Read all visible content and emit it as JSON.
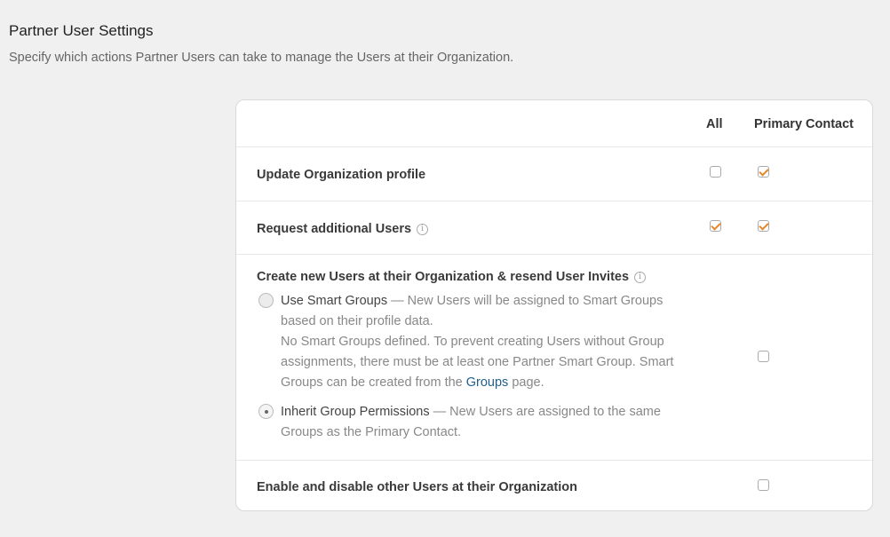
{
  "header": {
    "title": "Partner User Settings",
    "subtitle": "Specify which actions Partner Users can take to manage the Users at their Organization."
  },
  "table": {
    "columns": [
      "All",
      "Primary Contact"
    ],
    "rows": [
      {
        "label": "Update Organization profile",
        "all_checked": false,
        "primary_checked": true
      },
      {
        "label": "Request additional Users",
        "info": "i",
        "all_checked": true,
        "primary_checked": true
      },
      {
        "label": "Create new Users at their Organization & resend User Invites",
        "info": "i",
        "primary_checked": false,
        "options": [
          {
            "name": "Use Smart Groups",
            "desc": " — New Users will be assigned to Smart Groups based on their profile data.",
            "note_before_link": "No Smart Groups defined. To prevent creating Users without Group assignments, there must be at least one Partner Smart Group. Smart Groups can be created from the ",
            "link": "Groups",
            "note_after_link": " page.",
            "selected": false
          },
          {
            "name": "Inherit Group Permissions",
            "desc": " — New Users are assigned to the same Groups as the Primary Contact.",
            "selected": true
          }
        ]
      },
      {
        "label": "Enable and disable other Users at their Organization",
        "primary_checked": false
      }
    ]
  },
  "colors": {
    "accent_check": "#e8862b",
    "link": "#1f5f8b"
  },
  "icons": {
    "info": "info-circle-icon",
    "check": "checkmark-icon"
  }
}
